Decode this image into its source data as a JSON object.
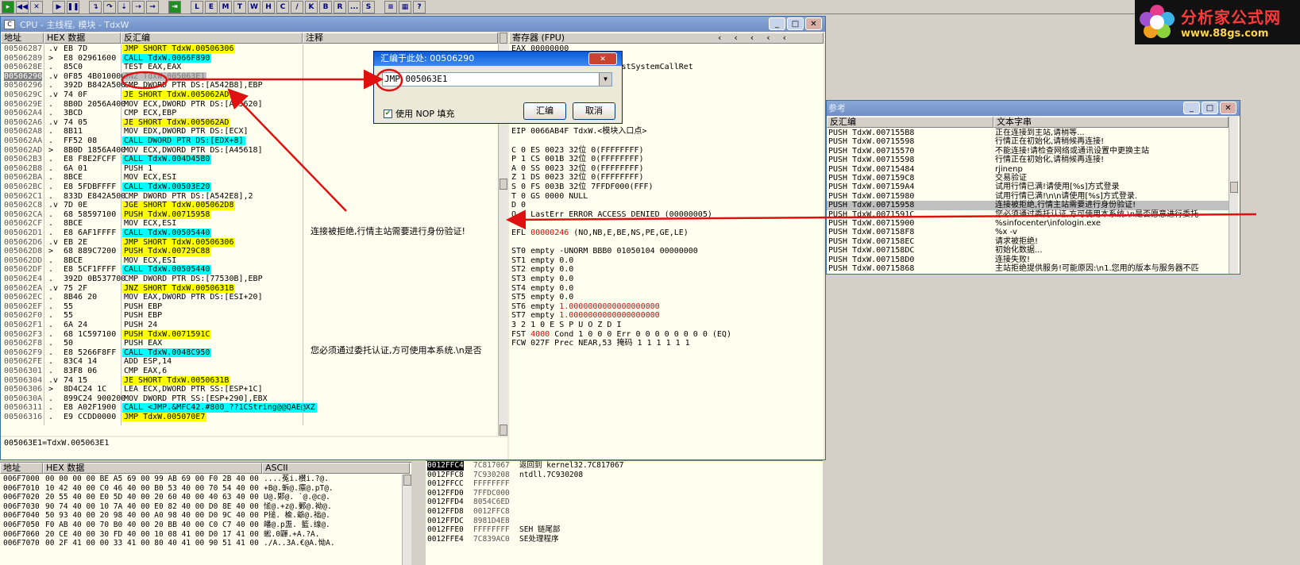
{
  "toolbar": {
    "buttons": [
      "L",
      "E",
      "M",
      "T",
      "W",
      "H",
      "C",
      "/",
      "K",
      "B",
      "R",
      "...",
      "S"
    ]
  },
  "logo": {
    "title": "分析家公式网",
    "url": "www.88gs.com"
  },
  "cpu_window": {
    "title": "CPU - 主线程, 模块 - TdxW",
    "headers": {
      "addr": "地址",
      "hex": "HEX 数据",
      "disasm": "反汇编",
      "comment": "注释"
    },
    "rows": [
      {
        "addr": "00506287",
        "mk": ".v",
        "hex": "EB 7D",
        "dis": "JMP SHORT TdxW.00506306",
        "hl": "y"
      },
      {
        "addr": "00506289",
        "mk": ">",
        "hex": "E8 02961600",
        "dis": "CALL TdxW.0066F890",
        "hl": "c"
      },
      {
        "addr": "0050628E",
        "mk": ".",
        "hex": "85C0",
        "dis": "TEST EAX,EAX",
        "hl": ""
      },
      {
        "addr": "00506290",
        "mk": ".v",
        "hex": "0F85 4B010000",
        "dis": "JNZ TdxW.005063E1",
        "hl": "g",
        "sel": true
      },
      {
        "addr": "00506296",
        "mk": ".",
        "hex": "392D B842A500",
        "dis": "CMP DWORD PTR DS:[A542B8],EBP",
        "hl": ""
      },
      {
        "addr": "0050629C",
        "mk": ".v",
        "hex": "74 0F",
        "dis": "JE SHORT TdxW.005062AD",
        "hl": "y"
      },
      {
        "addr": "0050629E",
        "mk": ".",
        "hex": "8B0D 2056A400",
        "dis": "MOV ECX,DWORD PTR DS:[A45620]",
        "hl": ""
      },
      {
        "addr": "005062A4",
        "mk": ".",
        "hex": "3BCD",
        "dis": "CMP ECX,EBP",
        "hl": ""
      },
      {
        "addr": "005062A6",
        "mk": ".v",
        "hex": "74 05",
        "dis": "JE SHORT TdxW.005062AD",
        "hl": "y"
      },
      {
        "addr": "005062A8",
        "mk": ".",
        "hex": "8B11",
        "dis": "MOV EDX,DWORD PTR DS:[ECX]",
        "hl": ""
      },
      {
        "addr": "005062AA",
        "mk": ".",
        "hex": "FF52 08",
        "dis": "CALL DWORD PTR DS:[EDX+8]",
        "hl": "c"
      },
      {
        "addr": "005062AD",
        "mk": ">",
        "hex": "8B0D 1856A400",
        "dis": "MOV ECX,DWORD PTR DS:[A45618]",
        "hl": ""
      },
      {
        "addr": "005062B3",
        "mk": ".",
        "hex": "E8 F8E2FCFF",
        "dis": "CALL TdxW.004D45B0",
        "hl": "c"
      },
      {
        "addr": "005062B8",
        "mk": ".",
        "hex": "6A 01",
        "dis": "PUSH 1",
        "hl": ""
      },
      {
        "addr": "005062BA",
        "mk": ".",
        "hex": "8BCE",
        "dis": "MOV ECX,ESI",
        "hl": ""
      },
      {
        "addr": "005062BC",
        "mk": ".",
        "hex": "E8 5FDBFFFF",
        "dis": "CALL TdxW.00503E20",
        "hl": "c"
      },
      {
        "addr": "005062C1",
        "mk": ".",
        "hex": "833D E842A500",
        "dis": "CMP DWORD PTR DS:[A542E8],2",
        "hl": ""
      },
      {
        "addr": "005062C8",
        "mk": ".v",
        "hex": "7D 0E",
        "dis": "JGE SHORT TdxW.005062D8",
        "hl": "y"
      },
      {
        "addr": "005062CA",
        "mk": ".",
        "hex": "68 58597100",
        "dis": "PUSH TdxW.00715958",
        "hl": "y"
      },
      {
        "addr": "005062CF",
        "mk": ".",
        "hex": "8BCE",
        "dis": "MOV ECX,ESI",
        "hl": ""
      },
      {
        "addr": "005062D1",
        "mk": ".",
        "hex": "E8 6AF1FFFF",
        "dis": "CALL TdxW.00505440",
        "hl": "c"
      },
      {
        "addr": "005062D6",
        "mk": ".v",
        "hex": "EB 2E",
        "dis": "JMP SHORT TdxW.00506306",
        "hl": "y"
      },
      {
        "addr": "005062D8",
        "mk": ">",
        "hex": "68 889C7200",
        "dis": "PUSH TdxW.00729C88",
        "hl": "y"
      },
      {
        "addr": "005062DD",
        "mk": ".",
        "hex": "8BCE",
        "dis": "MOV ECX,ESI",
        "hl": ""
      },
      {
        "addr": "005062DF",
        "mk": ".",
        "hex": "E8 5CF1FFFF",
        "dis": "CALL TdxW.00505440",
        "hl": "c"
      },
      {
        "addr": "005062E4",
        "mk": ".",
        "hex": "392D 0B537700",
        "dis": "CMP DWORD PTR DS:[77530B],EBP",
        "hl": ""
      },
      {
        "addr": "005062EA",
        "mk": ".v",
        "hex": "75 2F",
        "dis": "JNZ SHORT TdxW.0050631B",
        "hl": "y"
      },
      {
        "addr": "005062EC",
        "mk": ".",
        "hex": "8B46 20",
        "dis": "MOV EAX,DWORD PTR DS:[ESI+20]",
        "hl": ""
      },
      {
        "addr": "005062EF",
        "mk": ".",
        "hex": "55",
        "dis": "PUSH EBP",
        "hl": ""
      },
      {
        "addr": "005062F0",
        "mk": ".",
        "hex": "55",
        "dis": "PUSH EBP",
        "hl": ""
      },
      {
        "addr": "005062F1",
        "mk": ".",
        "hex": "6A 24",
        "dis": "PUSH 24",
        "hl": ""
      },
      {
        "addr": "005062F3",
        "mk": ".",
        "hex": "68 1C597100",
        "dis": "PUSH TdxW.0071591C",
        "hl": "y"
      },
      {
        "addr": "005062F8",
        "mk": ".",
        "hex": "50",
        "dis": "PUSH EAX",
        "hl": ""
      },
      {
        "addr": "005062F9",
        "mk": ".",
        "hex": "E8 5266F8FF",
        "dis": "CALL TdxW.0048C950",
        "hl": "c"
      },
      {
        "addr": "005062FE",
        "mk": ".",
        "hex": "83C4 14",
        "dis": "ADD ESP,14",
        "hl": ""
      },
      {
        "addr": "00506301",
        "mk": ".",
        "hex": "83F8 06",
        "dis": "CMP EAX,6",
        "hl": ""
      },
      {
        "addr": "00506304",
        "mk": ".v",
        "hex": "74 15",
        "dis": "JE SHORT TdxW.0050631B",
        "hl": "y"
      },
      {
        "addr": "00506306",
        "mk": ">",
        "hex": "8D4C24 1C",
        "dis": "LEA ECX,DWORD PTR SS:[ESP+1C]",
        "hl": ""
      },
      {
        "addr": "0050630A",
        "mk": ".",
        "hex": "899C24 900200",
        "dis": "MOV DWORD PTR SS:[ESP+290],EBX",
        "hl": ""
      },
      {
        "addr": "00506311",
        "mk": ".",
        "hex": "E8 A02F1900",
        "dis": "CALL <JMP.&MFC42.#800_??1CString@@QAE@XZ",
        "hl": "c"
      },
      {
        "addr": "00506316",
        "mk": ".",
        "hex": "E9 CCDD0000",
        "dis": "JMP TdxW.005070E7",
        "hl": "y"
      }
    ],
    "comment_1": "连接被拒绝,行情主站需要进行身份验证!",
    "comment_2": "您必须通过委托认证,方可使用本系统.\\n是否",
    "info_line": "005063E1=TdxW.005063E1",
    "reg_header": "寄存器 (FPU)",
    "registers": [
      "EAX 00000000",
      "ECX ...",
      "EDX 7C92E4F4 ntdll.KiFastSystemCallRet",
      "EBX 00000000",
      "ESP 0012FFC4",
      "EBP 0012FFF0",
      "ESI ...",
      "EDI 7C930208",
      "",
      "EIP 0066AB4F TdxW.<模块入口点>",
      "",
      "C 0   ES 0023 32位 0(FFFFFFFF)",
      "P 1   CS 001B 32位 0(FFFFFFFF)",
      "A 0   SS 0023 32位 0(FFFFFFFF)",
      "Z 1   DS 0023 32位 0(FFFFFFFF)",
      "S 0   FS 003B 32位 7FFDF000(FFF)",
      "T 0   GS 0000 NULL",
      "D 0",
      "O 0   LastErr ERROR_ACCESS_DENIED (00000005)",
      "",
      "EFL 00000246 (NO,NB,E,BE,NS,PE,GE,LE)",
      "",
      "ST0 empty -UNORM BBB0 01050104 00000000",
      "ST1 empty 0.0",
      "ST2 empty 0.0",
      "ST3 empty 0.0",
      "ST4 empty 0.0",
      "ST5 empty 0.0",
      "ST6 empty 1.0000000000000000000",
      "ST7 empty 1.0000000000000000000",
      "              3 2 1 0      E S P U O Z D I",
      "FST 4000  Cond 1 0 0 0  Err 0 0 0 0 0 0 0 0  (EQ)",
      "FCW 027F  Prec NEAR,53  掩码    1 1 1 1 1 1"
    ]
  },
  "dialog": {
    "title": "汇编于此处: 00506290",
    "input_value": "JMP 005063E1",
    "checkbox_label": "使用 NOP 填充",
    "ok_label": "汇编",
    "cancel_label": "取消"
  },
  "ref_window": {
    "title": "参考",
    "col_disasm": "反汇编",
    "col_text": "文本字串",
    "rows": [
      {
        "a": "PUSH TdxW.007155B8",
        "t": "正在连接到主站,请稍等..."
      },
      {
        "a": "PUSH TdxW.00715598",
        "t": "行情正在初始化,请稍候再连接!"
      },
      {
        "a": "PUSH TdxW.00715570",
        "t": "不能连接!请检查网络或通讯设置中更换主站"
      },
      {
        "a": "PUSH TdxW.00715598",
        "t": "行情正在初始化,请稍候再连接!"
      },
      {
        "a": "PUSH TdxW.00715484",
        "t": "rjinenp"
      },
      {
        "a": "PUSH TdxW.007159C8",
        "t": "交易验证"
      },
      {
        "a": "PUSH TdxW.007159A4",
        "t": "试用行情已满!请使用[%s]方式登录"
      },
      {
        "a": "PUSH TdxW.00715980",
        "t": "试用行情已满!\\n\\n请使用[%s]方式登录."
      },
      {
        "a": "PUSH TdxW.00715958",
        "t": "连接被拒绝,行情主站需要进行身份验证!",
        "sel": true
      },
      {
        "a": "PUSH TdxW.0071591C",
        "t": "您必须通过委托认证,方可使用本系统.\\n是否愿意进行委托"
      },
      {
        "a": "PUSH TdxW.00715900",
        "t": "%sinfocenter\\infologin.exe"
      },
      {
        "a": "PUSH TdxW.007158F8",
        "t": "%x -v"
      },
      {
        "a": "PUSH TdxW.007158EC",
        "t": "请求被拒绝!"
      },
      {
        "a": "PUSH TdxW.007158DC",
        "t": "初始化数据..."
      },
      {
        "a": "PUSH TdxW.007158D0",
        "t": "连接失败!"
      },
      {
        "a": "PUSH TdxW.00715868",
        "t": "主站拒绝提供服务!可能原因:\\n1.您用的版本与服务器不匹"
      }
    ]
  },
  "dump": {
    "headers": {
      "addr": "地址",
      "hex": "HEX 数据",
      "ascii": "ASCII"
    },
    "rows": [
      {
        "addr": "006F7000",
        "hex": "00 00 00 00 BE A5 69 00 99 AB 69 00 F0 2B 40 00",
        "ascii": "....菟i.櫕i.?@."
      },
      {
        "addr": "006F7010",
        "hex": "10 42 40 00 C0 46 40 00 B0 53 40 00 70 54 40 00",
        "ascii": "+B@.蚸@.癝@.pT@."
      },
      {
        "addr": "006F7020",
        "hex": "20 55 40 00 E0 5D 40 00 20 60 40 00 40 63 40 00",
        "ascii": " U@.郹@. `@.@c@."
      },
      {
        "addr": "006F7030",
        "hex": "90 74 40 00 10 7A 40 00 E0 82 40 00 D0 8E 40 00",
        "ascii": "恡@.+z@.鄛@.袎@."
      },
      {
        "addr": "006F7040",
        "hex": "50 93 40 00 20 98 40 00 A0 98 40 00 D0 9C 40 00",
        "ascii": "P搥. 楡.爺@.袦@."
      },
      {
        "addr": "006F7050",
        "hex": "F0 AB 40 00 70 B0 40 00 20 BB 40 00 C0 C7 40 00",
        "ascii": "皤@.p盄. 籃.缐@."
      },
      {
        "addr": "006F7060",
        "hex": "20 CE 40 00 30 FD 40 00 10 08 41 00 D0 17 41 00",
        "ascii": " 蜙.0鼲.+A.?A."
      },
      {
        "addr": "006F7070",
        "hex": "00 2F 41 00 00 33 41 00 80 40 41 00 90 51 41 00",
        "ascii": "./A..3A.€@A.怮A."
      }
    ]
  },
  "stack": {
    "rows": [
      {
        "addr": "0012FFC4",
        "val": "7C817067",
        "cmt": "返回到 kernel32.7C817067",
        "sel": true
      },
      {
        "addr": "0012FFC8",
        "val": "7C930208",
        "cmt": "ntdll.7C930208"
      },
      {
        "addr": "0012FFCC",
        "val": "FFFFFFFF",
        "cmt": ""
      },
      {
        "addr": "0012FFD0",
        "val": "7FFDC000",
        "cmt": ""
      },
      {
        "addr": "0012FFD4",
        "val": "8054C6ED",
        "cmt": ""
      },
      {
        "addr": "0012FFD8",
        "val": "0012FFC8",
        "cmt": ""
      },
      {
        "addr": "0012FFDC",
        "val": "8981D4E8",
        "cmt": ""
      },
      {
        "addr": "0012FFE0",
        "val": "FFFFFFFF",
        "cmt": "SEH 链尾部"
      },
      {
        "addr": "0012FFE4",
        "val": "7C839AC0",
        "cmt": "SE处理程序"
      }
    ]
  },
  "colors": {
    "yellow": "#ffff00",
    "cyan": "#00ffff",
    "arrow": "#e01010",
    "pane": "#fffff0"
  }
}
